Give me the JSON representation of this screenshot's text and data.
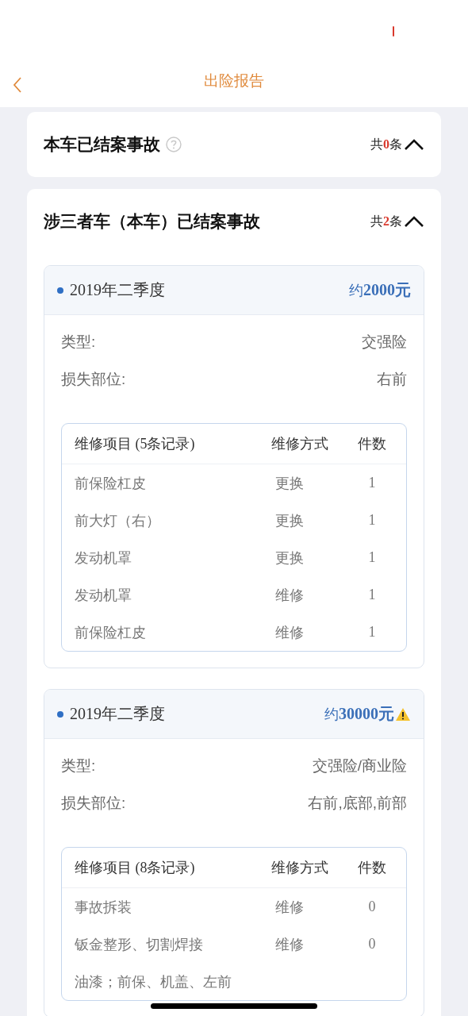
{
  "nav": {
    "title": "出险报告"
  },
  "sections": [
    {
      "title": "本车已结案事故",
      "help": true,
      "count": "共**0**条",
      "expanded": true
    },
    {
      "title": "涉三者车（本车）已结案事故",
      "help": false,
      "count": "共**2**条",
      "expanded": true,
      "accidents": [
        {
          "period": "2019年二季度",
          "amount": "约**2000元**",
          "warning": false,
          "fields": [
            {
              "label": "类型:",
              "value": "交强险"
            },
            {
              "label": "损失部位:",
              "value": "右前"
            }
          ],
          "table": {
            "columns": [
              "维修项目 (5条记录)",
              "维修方式",
              "件数"
            ],
            "rows": [
              [
                "前保险杠皮",
                "更换",
                "1"
              ],
              [
                "前大灯（右）",
                "更换",
                "1"
              ],
              [
                "发动机罩",
                "更换",
                "1"
              ],
              [
                "发动机罩",
                "维修",
                "1"
              ],
              [
                "前保险杠皮",
                "维修",
                "1"
              ]
            ]
          }
        },
        {
          "period": "2019年二季度",
          "amount": "约**30000元**",
          "warning": true,
          "fields": [
            {
              "label": "类型:",
              "value": "交强险/商业险"
            },
            {
              "label": "损失部位:",
              "value": "右前,底部,前部"
            }
          ],
          "table": {
            "columns": [
              "维修项目 (8条记录)",
              "维修方式",
              "件数"
            ],
            "rows": [
              [
                "事故拆装",
                "维修",
                "0"
              ],
              [
                "钣金整形、切割焊接",
                "维修",
                "0"
              ],
              [
                "油漆；前保、机盖、左前"
              ]
            ]
          }
        }
      ]
    }
  ]
}
